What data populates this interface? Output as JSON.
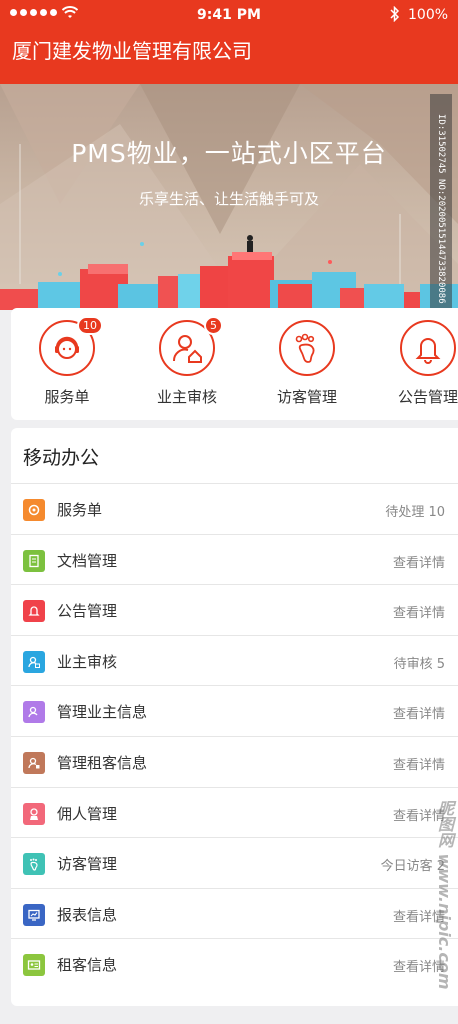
{
  "status": {
    "time": "9:41 PM",
    "battery": "100%"
  },
  "nav": {
    "title": "厦门建发物业管理有限公司"
  },
  "banner": {
    "headline": "PMS物业，一站式小区平台",
    "subline": "乐享生活、让生活触手可及",
    "watermark_id": "ID:31502745 NO:20200515144733820086"
  },
  "quick_actions": [
    {
      "label": "服务单",
      "badge": "10",
      "icon": "customer-service-icon"
    },
    {
      "label": "业主审核",
      "badge": "5",
      "icon": "owner-home-icon"
    },
    {
      "label": "访客管理",
      "badge": "",
      "icon": "footprint-icon"
    },
    {
      "label": "公告管理",
      "badge": "",
      "icon": "bell-icon"
    }
  ],
  "office": {
    "title": "移动办公",
    "items": [
      {
        "label": "服务单",
        "right": "待处理 10",
        "icon": "service-icon",
        "color": "#f58a2e"
      },
      {
        "label": "文档管理",
        "right": "查看详情",
        "icon": "document-icon",
        "color": "#7cc13f"
      },
      {
        "label": "公告管理",
        "right": "查看详情",
        "icon": "bell-icon",
        "color": "#f0424a"
      },
      {
        "label": "业主审核",
        "right": "待审核 5",
        "icon": "owner-icon",
        "color": "#2aa6e0"
      },
      {
        "label": "管理业主信息",
        "right": "查看详情",
        "icon": "owner-info-icon",
        "color": "#b07ae8"
      },
      {
        "label": "管理租客信息",
        "right": "查看详情",
        "icon": "tenant-info-icon",
        "color": "#c0785a"
      },
      {
        "label": "佣人管理",
        "right": "查看详情",
        "icon": "maid-icon",
        "color": "#f2687a"
      },
      {
        "label": "访客管理",
        "right": "今日访客 2",
        "icon": "footprint-icon",
        "color": "#3fc2b5"
      },
      {
        "label": "报表信息",
        "right": "查看详情",
        "icon": "report-icon",
        "color": "#3a66c4"
      },
      {
        "label": "租客信息",
        "right": "查看详情",
        "icon": "tenant-card-icon",
        "color": "#8cc63e"
      }
    ]
  },
  "watermark_site": "昵图网 www.nipic.com",
  "colors": {
    "primary": "#e8391f",
    "background": "#efeff1"
  }
}
